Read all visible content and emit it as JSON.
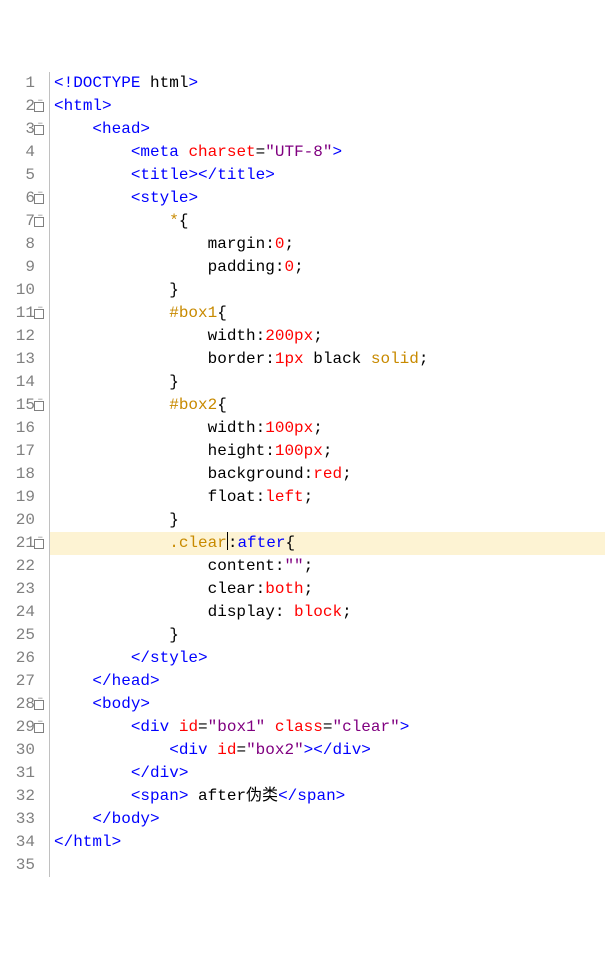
{
  "cursor_line": 21,
  "lines": [
    {
      "n": 1,
      "fold": false,
      "tokens": [
        {
          "c": "t-bracket",
          "t": "<!"
        },
        {
          "c": "t-tag",
          "t": "DOCTYPE"
        },
        {
          "c": "t-doctype",
          "t": " html"
        },
        {
          "c": "t-bracket",
          "t": ">"
        }
      ]
    },
    {
      "n": 2,
      "fold": true,
      "tokens": [
        {
          "c": "t-bracket",
          "t": "<"
        },
        {
          "c": "t-tag",
          "t": "html"
        },
        {
          "c": "t-bracket",
          "t": ">"
        }
      ]
    },
    {
      "n": 3,
      "fold": true,
      "indent": 1,
      "tokens": [
        {
          "c": "t-bracket",
          "t": "<"
        },
        {
          "c": "t-tag",
          "t": "head"
        },
        {
          "c": "t-bracket",
          "t": ">"
        }
      ]
    },
    {
      "n": 4,
      "fold": false,
      "indent": 2,
      "tokens": [
        {
          "c": "t-bracket",
          "t": "<"
        },
        {
          "c": "t-tag",
          "t": "meta"
        },
        {
          "c": "",
          "t": " "
        },
        {
          "c": "t-attr",
          "t": "charset"
        },
        {
          "c": "t-punct",
          "t": "="
        },
        {
          "c": "t-ident",
          "t": "\"UTF-8\""
        },
        {
          "c": "t-bracket",
          "t": ">"
        }
      ]
    },
    {
      "n": 5,
      "fold": false,
      "indent": 2,
      "tokens": [
        {
          "c": "t-bracket",
          "t": "<"
        },
        {
          "c": "t-tag",
          "t": "title"
        },
        {
          "c": "t-bracket",
          "t": ">"
        },
        {
          "c": "t-bracket",
          "t": "</"
        },
        {
          "c": "t-tag",
          "t": "title"
        },
        {
          "c": "t-bracket",
          "t": ">"
        }
      ]
    },
    {
      "n": 6,
      "fold": true,
      "indent": 2,
      "tokens": [
        {
          "c": "t-bracket",
          "t": "<"
        },
        {
          "c": "t-tag",
          "t": "style"
        },
        {
          "c": "t-bracket",
          "t": ">"
        }
      ]
    },
    {
      "n": 7,
      "fold": true,
      "indent": 3,
      "tokens": [
        {
          "c": "t-selector",
          "t": "*"
        },
        {
          "c": "t-punct",
          "t": "{"
        }
      ]
    },
    {
      "n": 8,
      "fold": false,
      "indent": 4,
      "tokens": [
        {
          "c": "t-prop",
          "t": "margin"
        },
        {
          "c": "t-punct",
          "t": ":"
        },
        {
          "c": "t-num",
          "t": "0"
        },
        {
          "c": "t-punct",
          "t": ";"
        }
      ]
    },
    {
      "n": 9,
      "fold": false,
      "indent": 4,
      "tokens": [
        {
          "c": "t-prop",
          "t": "padding"
        },
        {
          "c": "t-punct",
          "t": ":"
        },
        {
          "c": "t-num",
          "t": "0"
        },
        {
          "c": "t-punct",
          "t": ";"
        }
      ]
    },
    {
      "n": 10,
      "fold": false,
      "indent": 3,
      "tokens": [
        {
          "c": "t-punct",
          "t": "}"
        }
      ]
    },
    {
      "n": 11,
      "fold": true,
      "indent": 3,
      "tokens": [
        {
          "c": "t-selector",
          "t": "#box1"
        },
        {
          "c": "t-punct",
          "t": "{"
        }
      ]
    },
    {
      "n": 12,
      "fold": false,
      "indent": 4,
      "tokens": [
        {
          "c": "t-prop",
          "t": "width"
        },
        {
          "c": "t-punct",
          "t": ":"
        },
        {
          "c": "t-num",
          "t": "200px"
        },
        {
          "c": "t-punct",
          "t": ";"
        }
      ]
    },
    {
      "n": 13,
      "fold": false,
      "indent": 4,
      "tokens": [
        {
          "c": "t-prop",
          "t": "border"
        },
        {
          "c": "t-punct",
          "t": ":"
        },
        {
          "c": "t-num",
          "t": "1px"
        },
        {
          "c": "t-prop",
          "t": " black "
        },
        {
          "c": "t-selector",
          "t": "solid"
        },
        {
          "c": "t-punct",
          "t": ";"
        }
      ]
    },
    {
      "n": 14,
      "fold": false,
      "indent": 3,
      "tokens": [
        {
          "c": "t-punct",
          "t": "}"
        }
      ]
    },
    {
      "n": 15,
      "fold": true,
      "indent": 3,
      "tokens": [
        {
          "c": "t-selector",
          "t": "#box2"
        },
        {
          "c": "t-punct",
          "t": "{"
        }
      ]
    },
    {
      "n": 16,
      "fold": false,
      "indent": 4,
      "tokens": [
        {
          "c": "t-prop",
          "t": "width"
        },
        {
          "c": "t-punct",
          "t": ":"
        },
        {
          "c": "t-num",
          "t": "100px"
        },
        {
          "c": "t-punct",
          "t": ";"
        }
      ]
    },
    {
      "n": 17,
      "fold": false,
      "indent": 4,
      "tokens": [
        {
          "c": "t-prop",
          "t": "height"
        },
        {
          "c": "t-punct",
          "t": ":"
        },
        {
          "c": "t-num",
          "t": "100px"
        },
        {
          "c": "t-punct",
          "t": ";"
        }
      ]
    },
    {
      "n": 18,
      "fold": false,
      "indent": 4,
      "tokens": [
        {
          "c": "t-prop",
          "t": "background"
        },
        {
          "c": "t-punct",
          "t": ":"
        },
        {
          "c": "t-num",
          "t": "red"
        },
        {
          "c": "t-punct",
          "t": ";"
        }
      ]
    },
    {
      "n": 19,
      "fold": false,
      "indent": 4,
      "tokens": [
        {
          "c": "t-prop",
          "t": "float"
        },
        {
          "c": "t-punct",
          "t": ":"
        },
        {
          "c": "t-num",
          "t": "left"
        },
        {
          "c": "t-punct",
          "t": ";"
        }
      ]
    },
    {
      "n": 20,
      "fold": false,
      "indent": 3,
      "tokens": [
        {
          "c": "t-punct",
          "t": "}"
        }
      ]
    },
    {
      "n": 21,
      "fold": true,
      "indent": 3,
      "hl": true,
      "tokens": [
        {
          "c": "t-class",
          "t": ".clear"
        },
        {
          "cursor": true
        },
        {
          "c": "t-punct",
          "t": ":"
        },
        {
          "c": "t-pseudo",
          "t": "after"
        },
        {
          "c": "t-punct",
          "t": "{"
        }
      ]
    },
    {
      "n": 22,
      "fold": false,
      "indent": 4,
      "tokens": [
        {
          "c": "t-prop",
          "t": "content"
        },
        {
          "c": "t-punct",
          "t": ":"
        },
        {
          "c": "t-ident",
          "t": "\"\""
        },
        {
          "c": "t-punct",
          "t": ";"
        }
      ]
    },
    {
      "n": 23,
      "fold": false,
      "indent": 4,
      "tokens": [
        {
          "c": "t-prop",
          "t": "clear"
        },
        {
          "c": "t-punct",
          "t": ":"
        },
        {
          "c": "t-num",
          "t": "both"
        },
        {
          "c": "t-punct",
          "t": ";"
        }
      ]
    },
    {
      "n": 24,
      "fold": false,
      "indent": 4,
      "tokens": [
        {
          "c": "t-prop",
          "t": "display"
        },
        {
          "c": "t-punct",
          "t": ": "
        },
        {
          "c": "t-num",
          "t": "block"
        },
        {
          "c": "t-punct",
          "t": ";"
        }
      ]
    },
    {
      "n": 25,
      "fold": false,
      "indent": 3,
      "tokens": [
        {
          "c": "t-punct",
          "t": "}"
        }
      ]
    },
    {
      "n": 26,
      "fold": false,
      "indent": 2,
      "tokens": [
        {
          "c": "t-bracket",
          "t": "</"
        },
        {
          "c": "t-tag",
          "t": "style"
        },
        {
          "c": "t-bracket",
          "t": ">"
        }
      ]
    },
    {
      "n": 27,
      "fold": false,
      "indent": 1,
      "tokens": [
        {
          "c": "t-bracket",
          "t": "</"
        },
        {
          "c": "t-tag",
          "t": "head"
        },
        {
          "c": "t-bracket",
          "t": ">"
        }
      ]
    },
    {
      "n": 28,
      "fold": true,
      "indent": 1,
      "tokens": [
        {
          "c": "t-bracket",
          "t": "<"
        },
        {
          "c": "t-tag",
          "t": "body"
        },
        {
          "c": "t-bracket",
          "t": ">"
        }
      ]
    },
    {
      "n": 29,
      "fold": true,
      "indent": 2,
      "tokens": [
        {
          "c": "t-bracket",
          "t": "<"
        },
        {
          "c": "t-tag",
          "t": "div"
        },
        {
          "c": "",
          "t": " "
        },
        {
          "c": "t-attr",
          "t": "id"
        },
        {
          "c": "t-punct",
          "t": "="
        },
        {
          "c": "t-ident",
          "t": "\"box1\""
        },
        {
          "c": "",
          "t": " "
        },
        {
          "c": "t-attr",
          "t": "class"
        },
        {
          "c": "t-punct",
          "t": "="
        },
        {
          "c": "t-ident",
          "t": "\"clear\""
        },
        {
          "c": "t-bracket",
          "t": ">"
        }
      ]
    },
    {
      "n": 30,
      "fold": false,
      "indent": 3,
      "tokens": [
        {
          "c": "t-bracket",
          "t": "<"
        },
        {
          "c": "t-tag",
          "t": "div"
        },
        {
          "c": "",
          "t": " "
        },
        {
          "c": "t-attr",
          "t": "id"
        },
        {
          "c": "t-punct",
          "t": "="
        },
        {
          "c": "t-ident",
          "t": "\"box2\""
        },
        {
          "c": "t-bracket",
          "t": ">"
        },
        {
          "c": "t-bracket",
          "t": "</"
        },
        {
          "c": "t-tag",
          "t": "div"
        },
        {
          "c": "t-bracket",
          "t": ">"
        }
      ]
    },
    {
      "n": 31,
      "fold": false,
      "indent": 2,
      "tokens": [
        {
          "c": "t-bracket",
          "t": "</"
        },
        {
          "c": "t-tag",
          "t": "div"
        },
        {
          "c": "t-bracket",
          "t": ">"
        }
      ]
    },
    {
      "n": 32,
      "fold": false,
      "indent": 2,
      "tokens": [
        {
          "c": "t-bracket",
          "t": "<"
        },
        {
          "c": "t-tag",
          "t": "span"
        },
        {
          "c": "t-bracket",
          "t": ">"
        },
        {
          "c": "t-text",
          "t": " after伪类"
        },
        {
          "c": "t-bracket",
          "t": "</"
        },
        {
          "c": "t-tag",
          "t": "span"
        },
        {
          "c": "t-bracket",
          "t": ">"
        }
      ]
    },
    {
      "n": 33,
      "fold": false,
      "indent": 1,
      "tokens": [
        {
          "c": "t-bracket",
          "t": "</"
        },
        {
          "c": "t-tag",
          "t": "body"
        },
        {
          "c": "t-bracket",
          "t": ">"
        }
      ]
    },
    {
      "n": 34,
      "fold": false,
      "indent": 0,
      "tokens": [
        {
          "c": "t-bracket",
          "t": "</"
        },
        {
          "c": "t-tag",
          "t": "html"
        },
        {
          "c": "t-bracket",
          "t": ">"
        }
      ]
    },
    {
      "n": 35,
      "fold": false,
      "indent": 0,
      "tokens": []
    }
  ]
}
